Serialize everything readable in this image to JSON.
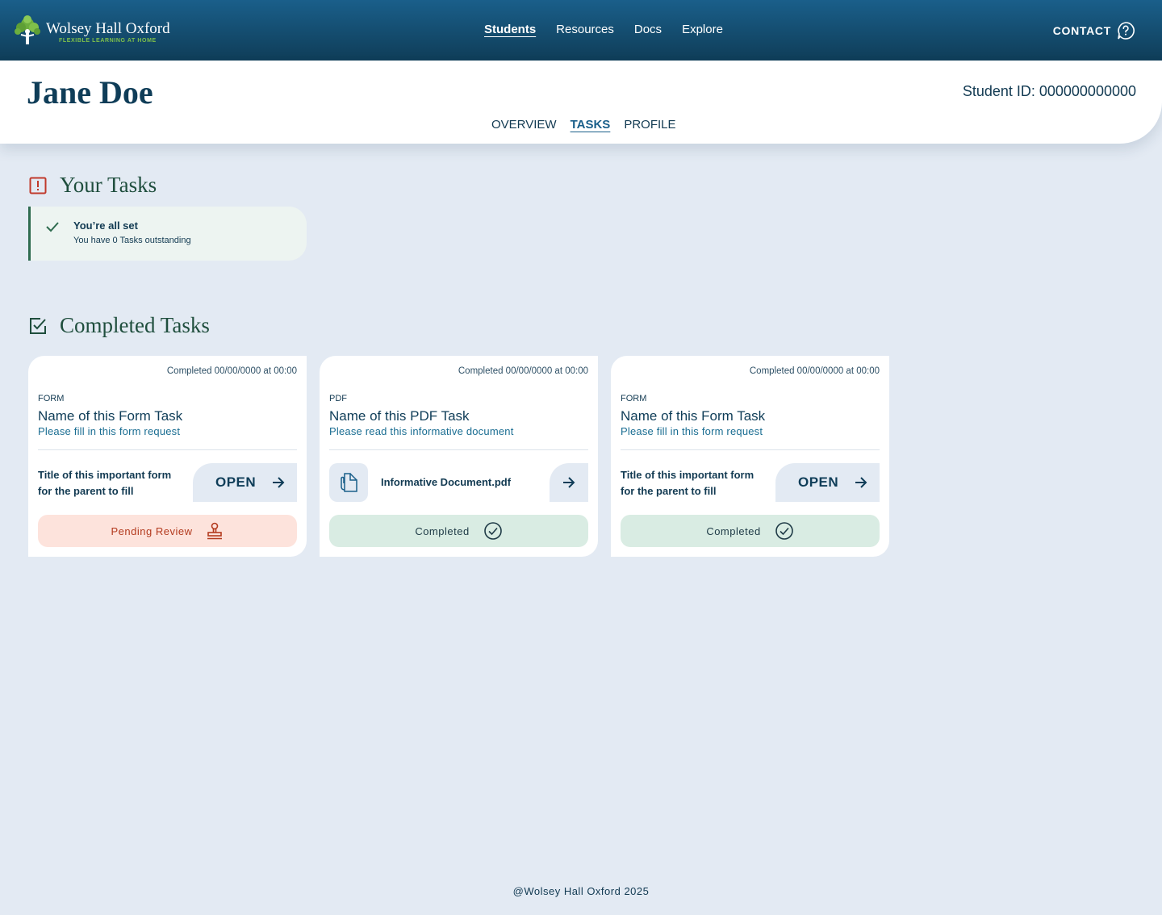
{
  "brand": {
    "name": "Wolsey Hall Oxford",
    "tagline": "FLEXIBLE LEARNING AT HOME"
  },
  "nav": [
    {
      "label": "Students",
      "active": true
    },
    {
      "label": "Resources",
      "active": false
    },
    {
      "label": "Docs",
      "active": false
    },
    {
      "label": "Explore",
      "active": false
    }
  ],
  "contact": {
    "label": "CONTACT",
    "icon": "help-bubble-icon"
  },
  "student": {
    "name": "Jane Doe",
    "id_text": "Student ID: 000000000000"
  },
  "subtabs": [
    {
      "label": "OVERVIEW",
      "active": false
    },
    {
      "label": "TASKS",
      "active": true
    },
    {
      "label": "PROFILE",
      "active": false
    }
  ],
  "your_tasks": {
    "title": "Your Tasks",
    "icon": "alert-square-icon",
    "status_title": "You’re all set",
    "status_subtitle": "You have 0 Tasks outstanding"
  },
  "completed": {
    "title": "Completed Tasks",
    "icon": "checkbox-icon",
    "cards": [
      {
        "completed_at": "Completed 00/00/0000 at 00:00",
        "kind": "FORM",
        "title": "Name of this Form Task",
        "subtitle": "Please fill in this form request",
        "item_label": "Title of this important form for the parent to fill",
        "action_label": "OPEN",
        "status": "Pending Review",
        "status_icon": "stamp-icon"
      },
      {
        "completed_at": "Completed 00/00/0000 at 00:00",
        "kind": "PDF",
        "title": "Name of this PDF Task",
        "subtitle": "Please read this informative document",
        "item_label": "Informative Document.pdf",
        "status": "Completed",
        "status_icon": "check-circle-icon"
      },
      {
        "completed_at": "Completed 00/00/0000 at 00:00",
        "kind": "FORM",
        "title": "Name of this Form Task",
        "subtitle": "Please fill in this form request",
        "item_label": "Title of this important form for the parent to fill",
        "action_label": "OPEN",
        "status": "Completed",
        "status_icon": "check-circle-icon"
      }
    ]
  },
  "footer": {
    "text": "@Wolsey Hall Oxford 2025"
  },
  "colors": {
    "header": "#0f3d58",
    "accent": "#1a5f8a",
    "alert": "#c0392b",
    "success": "#2e6b4f",
    "pending_bg": "#fde3dc",
    "done_bg": "#d9ece3"
  }
}
